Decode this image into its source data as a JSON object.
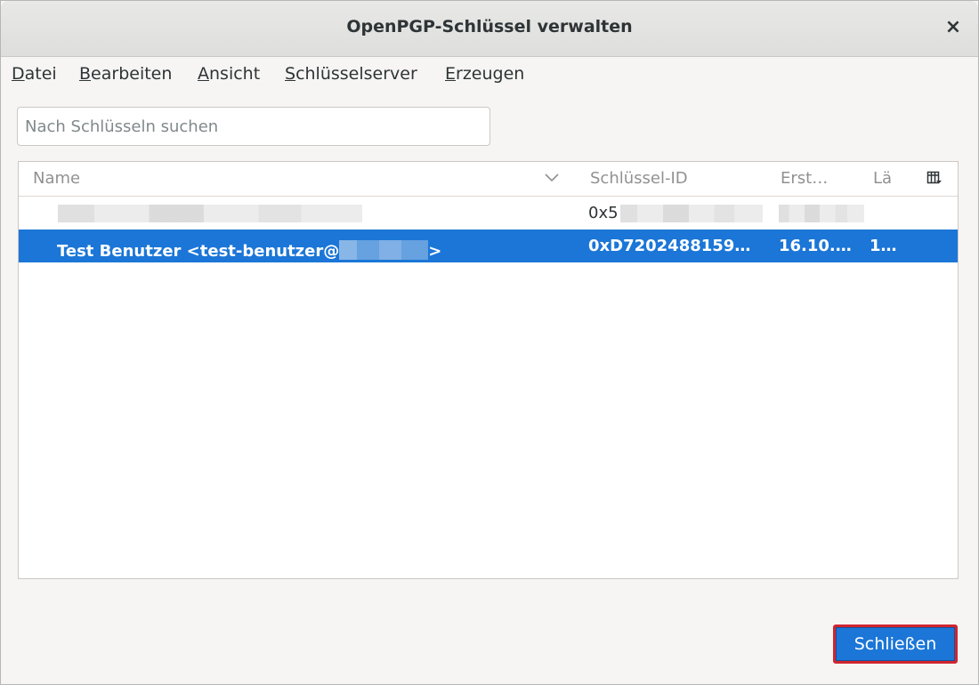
{
  "window": {
    "title": "OpenPGP-Schlüssel verwalten",
    "close_glyph": "×"
  },
  "menubar": {
    "items": [
      {
        "accel": "D",
        "rest": "atei"
      },
      {
        "accel": "B",
        "rest": "earbeiten"
      },
      {
        "accel": "A",
        "rest": "nsicht"
      },
      {
        "accel": "S",
        "rest": "chlüsselserver"
      },
      {
        "accel": "E",
        "rest": "rzeugen"
      }
    ]
  },
  "search": {
    "placeholder": "Nach Schlüsseln suchen",
    "value": ""
  },
  "table": {
    "columns": [
      "Name",
      "Schlüssel-ID",
      "Erst…",
      "Lä"
    ],
    "sort_icon": "chevron-down-icon",
    "column_picker_icon": "column-picker-icon",
    "rows": [
      {
        "name": "",
        "key_id": "0x5",
        "created": "",
        "length": "",
        "selected": false
      },
      {
        "name": "Test Benutzer <test-benutzer@",
        "name_suffix": ">",
        "key_id": "0xD7202488159…",
        "created": "16.10.…",
        "length": "1…",
        "selected": true
      }
    ]
  },
  "footer": {
    "close_label": "Schließen"
  },
  "colors": {
    "accent": "#1b76d7",
    "highlight_border": "#d1242f"
  }
}
